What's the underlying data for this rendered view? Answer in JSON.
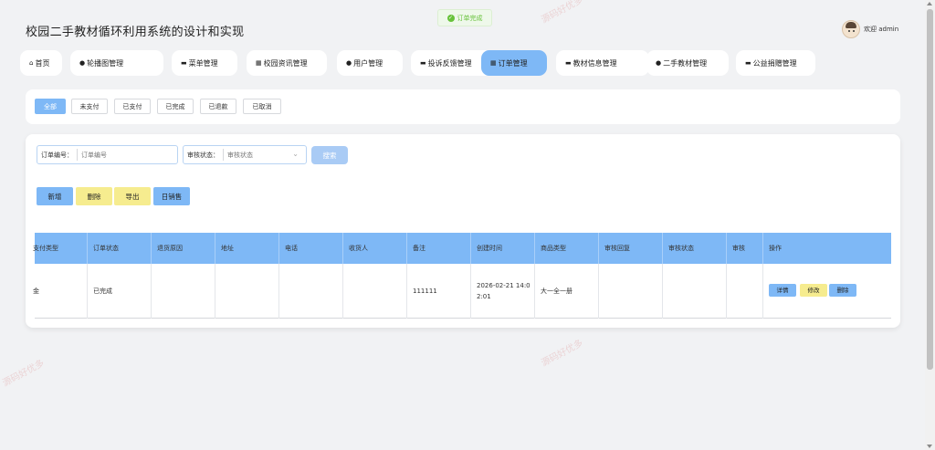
{
  "toast": {
    "text": "订单完成"
  },
  "header": {
    "title": "校园二手教材循环利用系统的设计和实现",
    "welcome": "欢迎 admin"
  },
  "nav": {
    "items": [
      {
        "icon": "⌂",
        "label": "首页"
      },
      {
        "icon": "●",
        "label": "轮播图管理"
      },
      {
        "icon": "▬",
        "label": "菜单管理"
      },
      {
        "icon": "▦",
        "label": "校园资讯管理"
      },
      {
        "icon": "●",
        "label": "用户管理"
      },
      {
        "icon": "▬",
        "label": "投诉反馈管理"
      },
      {
        "icon": "▦",
        "label": "订单管理"
      },
      {
        "icon": "▬",
        "label": "教材信息管理"
      },
      {
        "icon": "●",
        "label": "二手教材管理"
      },
      {
        "icon": "▬",
        "label": "公益捐赠管理"
      }
    ],
    "active_index": 6
  },
  "status_tabs": [
    "全部",
    "未支付",
    "已支付",
    "已完成",
    "已退款",
    "已取消"
  ],
  "filters": {
    "order_no_label": "订单编号：",
    "order_no_placeholder": "订单编号",
    "review_label": "审核状态：",
    "review_placeholder": "审核状态",
    "search_label": "搜索"
  },
  "actions": {
    "add": "新增",
    "delete": "删除",
    "export": "导出",
    "daily_sales": "日销售"
  },
  "table": {
    "headers": [
      "支付类型",
      "订单状态",
      "退货原因",
      "地址",
      "电话",
      "收货人",
      "备注",
      "创建时间",
      "商品类型",
      "审核回复",
      "审核状态",
      "审核",
      "操作"
    ],
    "rows": [
      {
        "cells": [
          "金",
          "已完成",
          "",
          "",
          "",
          "",
          "111111",
          "2026-02-21 14:02:01",
          "大一全一册",
          "",
          "",
          ""
        ]
      }
    ],
    "row_ops": {
      "detail": "详情",
      "edit": "修改",
      "delete": "删除"
    }
  },
  "watermark": "源码好优多",
  "colors": {
    "primary": "#7eb8f6",
    "warning": "#f6ec8f",
    "success": "#67c23a"
  }
}
